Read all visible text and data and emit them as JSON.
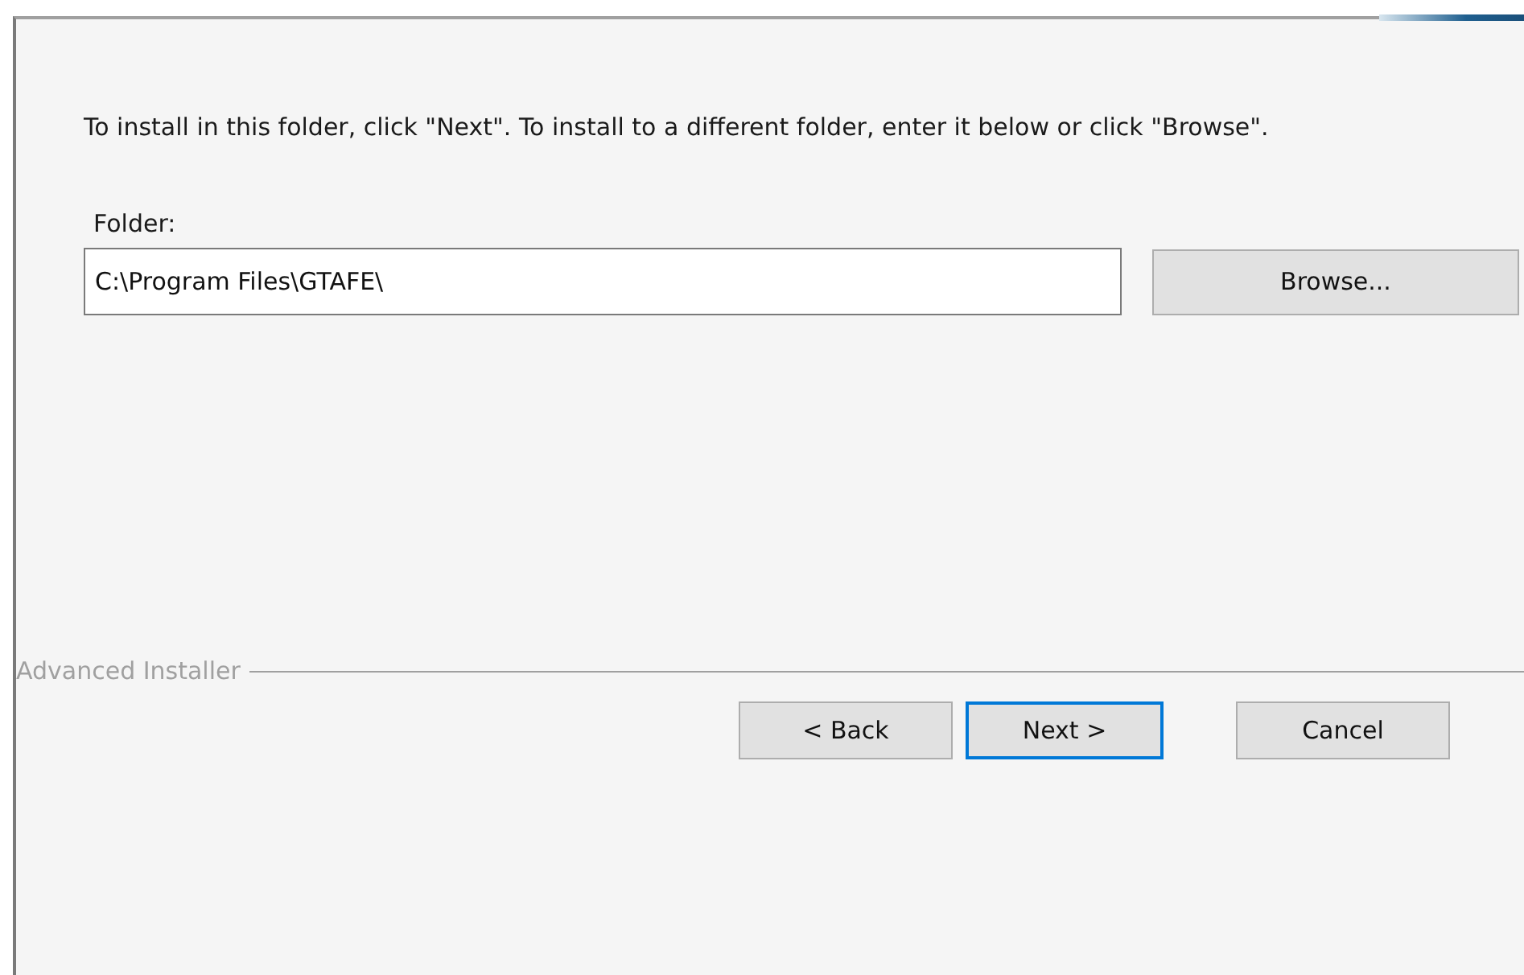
{
  "instructions": "To install in this folder, click \"Next\". To install to a different folder, enter it below or click \"Browse\".",
  "folder": {
    "label": "Folder:",
    "value": "C:\\Program Files\\GTAFE\\",
    "browse_button": "Browse..."
  },
  "footer": {
    "brand": "Advanced Installer"
  },
  "buttons": [
    {
      "label": "< Back",
      "default": false
    },
    {
      "label": "Next >",
      "default": true
    },
    {
      "label": "Cancel",
      "default": false
    }
  ]
}
